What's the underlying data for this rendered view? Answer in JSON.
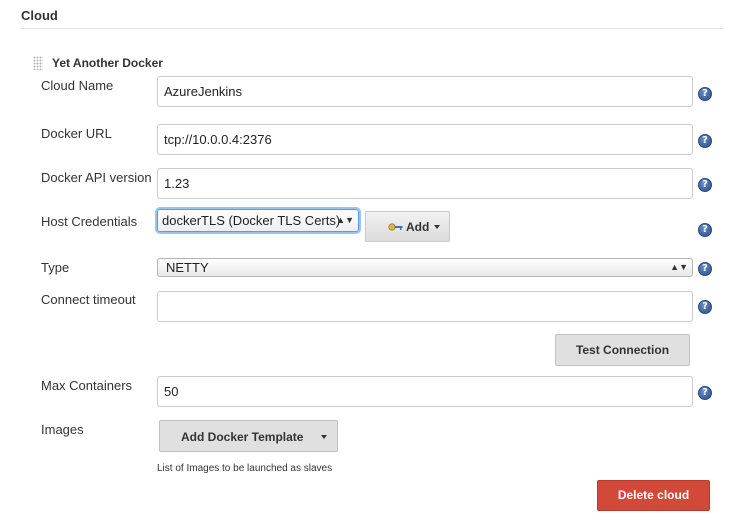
{
  "section": {
    "title": "Cloud"
  },
  "cloud": {
    "block_title": "Yet Another Docker",
    "help_glyph": "?",
    "fields": {
      "cloud_name": {
        "label": "Cloud Name",
        "value": "AzureJenkins"
      },
      "docker_url": {
        "label": "Docker URL",
        "value": "tcp://10.0.0.4:2376"
      },
      "docker_api_version": {
        "label": "Docker API version",
        "value": "1.23"
      },
      "host_credentials": {
        "label": "Host Credentials",
        "value": "dockerTLS (Docker TLS Certs)",
        "add_label": "Add"
      },
      "type": {
        "label": "Type",
        "value": "NETTY"
      },
      "connect_timeout": {
        "label": "Connect timeout",
        "value": ""
      },
      "max_containers": {
        "label": "Max Containers",
        "value": "50"
      },
      "images": {
        "label": "Images",
        "button_label": "Add Docker Template",
        "description": "List of Images to be launched as slaves"
      }
    },
    "test_connection_label": "Test Connection",
    "delete_cloud_label": "Delete cloud",
    "select_arrows_glyph": "▲▼",
    "icons": {
      "help": "help-icon",
      "key": "key-icon",
      "drag": "drag-handle-icon",
      "caret": "caret-down-icon"
    },
    "colors": {
      "delete_button": "#d24939",
      "help_icon": "#3a5f9a",
      "focus_ring": "#9cc3f0"
    }
  }
}
